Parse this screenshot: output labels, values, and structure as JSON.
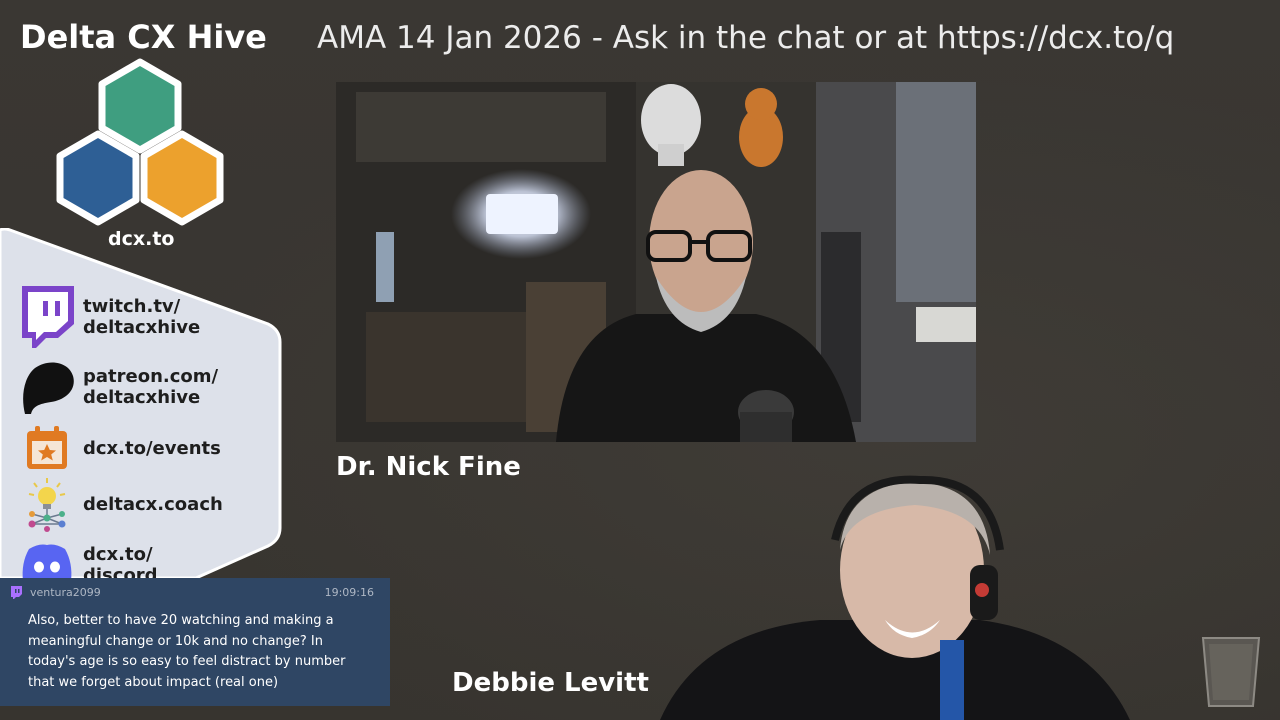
{
  "brand": {
    "title": "Delta CX Hive",
    "logo_caption": "dcx.to",
    "colors": {
      "green": "#3f9e80",
      "blue": "#2e5f95",
      "orange": "#eca12d"
    }
  },
  "banner": {
    "text": "AMA 14 Jan 2026 - Ask in the chat or at https://dcx.to/q"
  },
  "links": [
    {
      "icon": "twitch-icon",
      "line1": "twitch.tv/",
      "line2": "deltacxhive"
    },
    {
      "icon": "patreon-icon",
      "line1": "patreon.com/",
      "line2": "deltacxhive"
    },
    {
      "icon": "calendar-star-icon",
      "line1": "dcx.to/events",
      "line2": ""
    },
    {
      "icon": "lightbulb-network-icon",
      "line1": "deltacx.coach",
      "line2": ""
    },
    {
      "icon": "discord-icon",
      "line1": "dcx.to/",
      "line2": "discord"
    }
  ],
  "speakers": {
    "main": "Dr. Nick Fine",
    "second": "Debbie Levitt"
  },
  "chat": {
    "platform_icon": "twitch-icon",
    "username": "ventura2099",
    "time": "19:09:16",
    "message": "Also, better to have 20 watching and making a meaningful change or 10k and no change? In today's age is so easy to feel distract by number that we forget about impact (real one)"
  }
}
